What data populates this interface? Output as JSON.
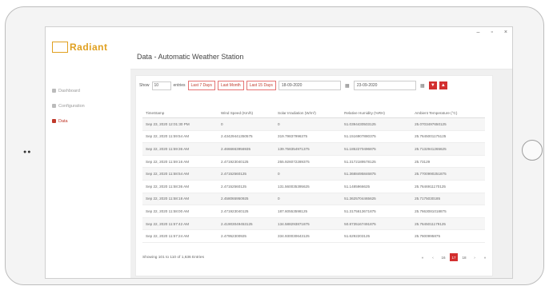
{
  "window": {
    "minimize": "–",
    "maximize": "▫",
    "close": "×"
  },
  "logo": "Radiant",
  "sidebar": [
    {
      "label": "Dashboard",
      "icon": "dashboard-icon",
      "active": false
    },
    {
      "label": "Configuration",
      "icon": "gear-icon",
      "active": false
    },
    {
      "label": "Data",
      "icon": "folder-icon",
      "active": true
    }
  ],
  "page_title": "Data - Automatic Weather Station",
  "toolbar": {
    "show_label": "Show",
    "show_value": "10",
    "entries_label": "entries",
    "quick": [
      "Last 7 Days",
      "Last Month",
      "Last 15 Days"
    ],
    "date_from": "18-09-2020",
    "date_to": "23-09-2020"
  },
  "table": {
    "headers": [
      "TimeStamp",
      "Wind Speed (Km/h)",
      "Solar Irradiation (W/m²)",
      "Relative Humidity (%RH)",
      "Ambient Temperature (°C)"
    ],
    "rows": [
      [
        "Sep 23, 2020 12:01:30 PM",
        "0",
        "0",
        "51.0394430503125",
        "25.0703497650125"
      ],
      [
        "Sep 22, 2020 11:59:54 AM",
        "2.43429441350575",
        "319.79837996375",
        "51.1516907880375",
        "25.7645001175125"
      ],
      [
        "Sep 22, 2020 11:59:36 AM",
        "2.4666663956935",
        "139.758354971375",
        "51.1852270496875",
        "25.7132941265625"
      ],
      [
        "Sep 22, 2020 11:59:16 AM",
        "2.471923040125",
        "255.926072289375",
        "51.3172189578125",
        "25.73129"
      ],
      [
        "Sep 22, 2020 11:58:54 AM",
        "2.47152560125",
        "0",
        "51.3688495846875",
        "25.7700990251875"
      ],
      [
        "Sep 22, 2020 11:58:36 AM",
        "2.47152560125",
        "131.560035395625",
        "51.1485966625",
        "25.7646911170125"
      ],
      [
        "Sep 22, 2020 11:58:18 AM",
        "2.458065950925",
        "0",
        "51.3625704465625",
        "25.7175030185"
      ],
      [
        "Sep 22, 2020 11:58:00 AM",
        "2.471923040125",
        "187.60553598125",
        "51.3175613671875",
        "25.7663081018875"
      ],
      [
        "Sep 22, 2020 11:57:42 AM",
        "2.41903049453125",
        "134.588293871875",
        "50.8735167491875",
        "25.7645011179125"
      ],
      [
        "Sep 22, 2020 11:57:24 AM",
        "2.47952300925",
        "334.930030643125",
        "51.6292203125",
        "25.7600995875"
      ]
    ]
  },
  "info": "Showing 101 to 110 of 1,636 Entries",
  "pager": [
    "«",
    "‹",
    "16",
    "17",
    "18",
    "›",
    "»"
  ],
  "pager_active_index": 3
}
